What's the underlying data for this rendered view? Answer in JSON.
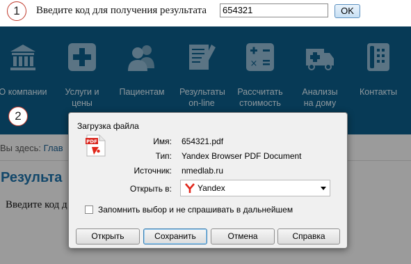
{
  "step_markers": {
    "one": "1",
    "two": "2"
  },
  "top_form": {
    "prompt": "Введите код для получения результата",
    "code_value": "654321",
    "ok_label": "OK"
  },
  "nav": {
    "items": [
      {
        "label": "О компании",
        "icon": "building-icon"
      },
      {
        "label": "Услуги и цены",
        "icon": "medical-cross-icon"
      },
      {
        "label": "Пациентам",
        "icon": "people-icon"
      },
      {
        "label": "Результаты on-line",
        "icon": "document-pen-icon"
      },
      {
        "label": "Рассчитать стоимость",
        "icon": "calculator-icon"
      },
      {
        "label": "Анализы на дому",
        "icon": "ambulance-icon"
      },
      {
        "label": "Контакты",
        "icon": "phone-icon"
      }
    ]
  },
  "page": {
    "breadcrumb_prefix": "Вы здесь:",
    "breadcrumb_link": "Глав",
    "title": "Результа",
    "prompt": "Введите код д"
  },
  "dialog": {
    "title": "Загрузка файла",
    "name_label": "Имя:",
    "name_value": "654321.pdf",
    "type_label": "Тип:",
    "type_value": "Yandex Browser PDF Document",
    "source_label": "Источник:",
    "source_value": "nmedlab.ru",
    "open_with_label": "Открыть в:",
    "open_with_value": "Yandex",
    "remember_label": "Запомнить выбор и не спрашивать в дальнейшем",
    "remember_checked": false,
    "buttons": {
      "open": "Открыть",
      "save": "Сохранить",
      "cancel": "Отмена",
      "help": "Справка"
    },
    "pdf_icon_text": "PDF"
  },
  "colors": {
    "nav_background": "#0c5a85",
    "nav_text": "#d6e6f0",
    "title_blue": "#1c6da4",
    "marker_red": "#c0392b"
  }
}
